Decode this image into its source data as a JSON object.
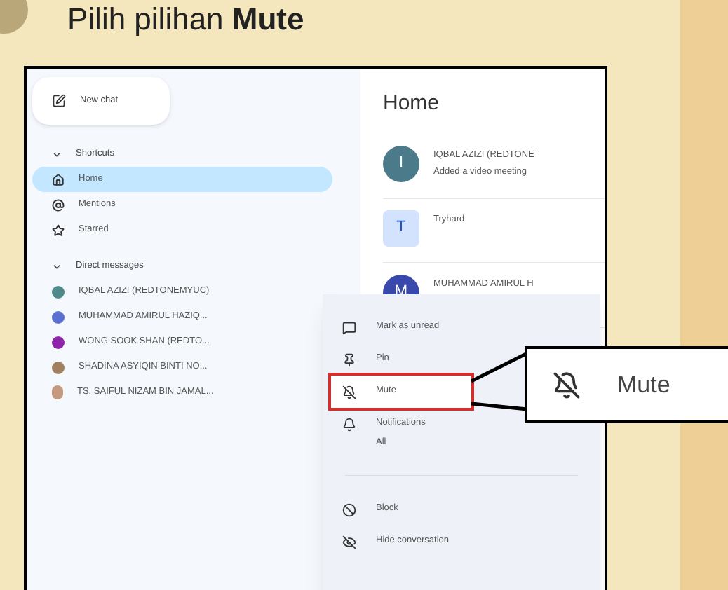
{
  "heading": {
    "text": "Pilih pilihan **Mute**"
  },
  "sidebar": {
    "new_chat": "New chat",
    "sections": [
      {
        "title": "Shortcuts",
        "expanded": true,
        "items": [
          {
            "label": "Home",
            "selected": true
          },
          {
            "label": "Mentions",
            "selected": false
          },
          {
            "label": "Starred",
            "selected": false
          }
        ]
      },
      {
        "title": "Direct messages",
        "expanded": true,
        "items": [
          {
            "label": "IQBAL AZIZI (REDTONEMYUC)",
            "kind": "avatar",
            "color": "#4f8a8b",
            "selected": false
          },
          {
            "label": "MUHAMMAD AMIRUL HAZIQ...",
            "kind": "avatar",
            "color": "#5b6fd0",
            "selected": false
          },
          {
            "label": "WONG SOOK SHAN (REDTO...",
            "kind": "avatar",
            "color": "#8e24aa",
            "selected": false
          },
          {
            "label": "SHADINA ASYIQIN BINTI NO...",
            "kind": "avatar",
            "color": "#a08060",
            "selected": false
          },
          {
            "label": "TS. SAIFUL NIZAM BIN JAMAL...",
            "kind": "photo",
            "selected": false
          }
        ]
      }
    ]
  },
  "main": {
    "title": "Home",
    "conversations": [
      {
        "avatar": "I",
        "kind": "circle",
        "color": "#4b7a8a",
        "name": "IQBAL AZIZI (REDTONE",
        "subtitle": "Added a video meeting"
      },
      {
        "avatar": "T",
        "kind": "square",
        "color": "#d3e3fd",
        "name": "Tryhard"
      },
      {
        "avatar": "M",
        "kind": "circle",
        "color": "#3949ab",
        "name": "MUHAMMAD AMIRUL H"
      }
    ]
  },
  "menu": {
    "items": [
      {
        "kind": "item",
        "label": "Mark as unread",
        "selected": false
      },
      {
        "kind": "item",
        "label": "Pin",
        "selected": false
      },
      {
        "kind": "item",
        "label": "Mute",
        "selected": true
      },
      {
        "kind": "item",
        "label": "Notifications",
        "sublabel": "All",
        "selected": false
      },
      {
        "kind": "divider"
      },
      {
        "kind": "item",
        "label": "Block",
        "selected": false
      },
      {
        "kind": "item",
        "label": "Hide conversation",
        "selected": false
      }
    ]
  },
  "callout": {
    "label": "Mute"
  }
}
